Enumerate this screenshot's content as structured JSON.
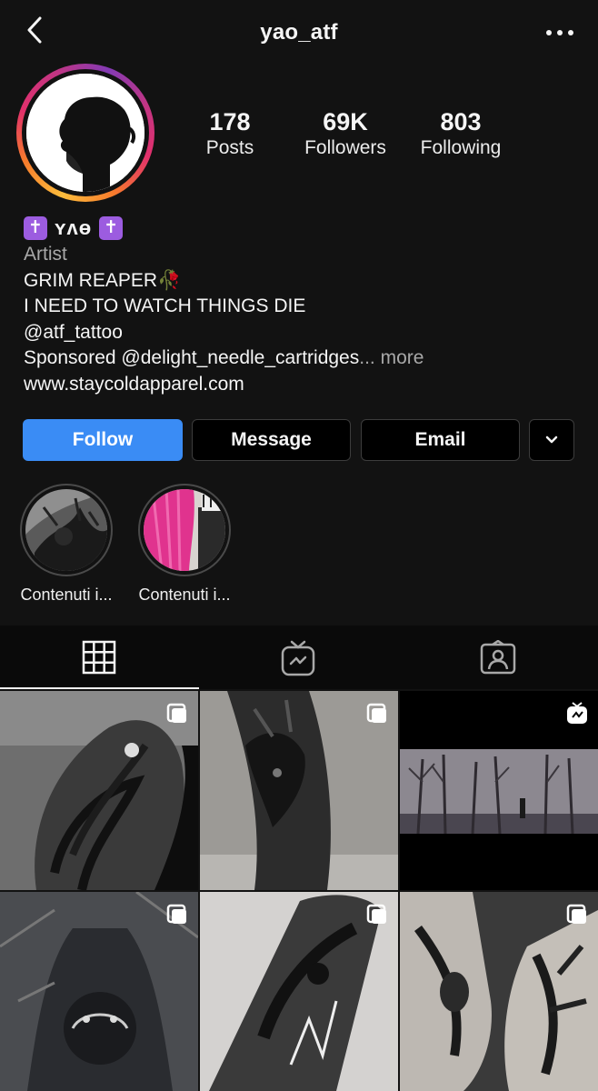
{
  "header": {
    "username": "yao_atf",
    "back_icon": "chevron-left-icon",
    "menu_icon": "more-horizontal-icon"
  },
  "stats": [
    {
      "value": "178",
      "label": "Posts"
    },
    {
      "value": "69K",
      "label": "Followers"
    },
    {
      "value": "803",
      "label": "Following"
    }
  ],
  "bio": {
    "display_name": "ʏʌɵ",
    "cross_glyph": "✝",
    "category": "Artist",
    "lines": [
      "GRIM REAPER🥀",
      "I NEED TO WATCH THINGS DIE",
      "@atf_tattoo"
    ],
    "sponsored": "Sponsored @delight_needle_cartridges",
    "ellipsis": "...",
    "more": "more",
    "website": "www.staycoldapparel.com"
  },
  "buttons": {
    "follow": "Follow",
    "message": "Message",
    "email": "Email",
    "dropdown_icon": "chevron-down-icon"
  },
  "highlights": [
    {
      "label": "Contenuti i..."
    },
    {
      "label": "Contenuti i..."
    }
  ],
  "tabs": [
    {
      "name": "grid",
      "icon": "grid-icon",
      "active": true
    },
    {
      "name": "igtv",
      "icon": "igtv-icon",
      "active": false
    },
    {
      "name": "tagged",
      "icon": "tagged-person-icon",
      "active": false
    }
  ],
  "colors": {
    "background": "#121212",
    "follow_blue": "#3a8cf5",
    "muted_text": "#a8a8a8",
    "highlight_purple": "#9c5ce0"
  }
}
